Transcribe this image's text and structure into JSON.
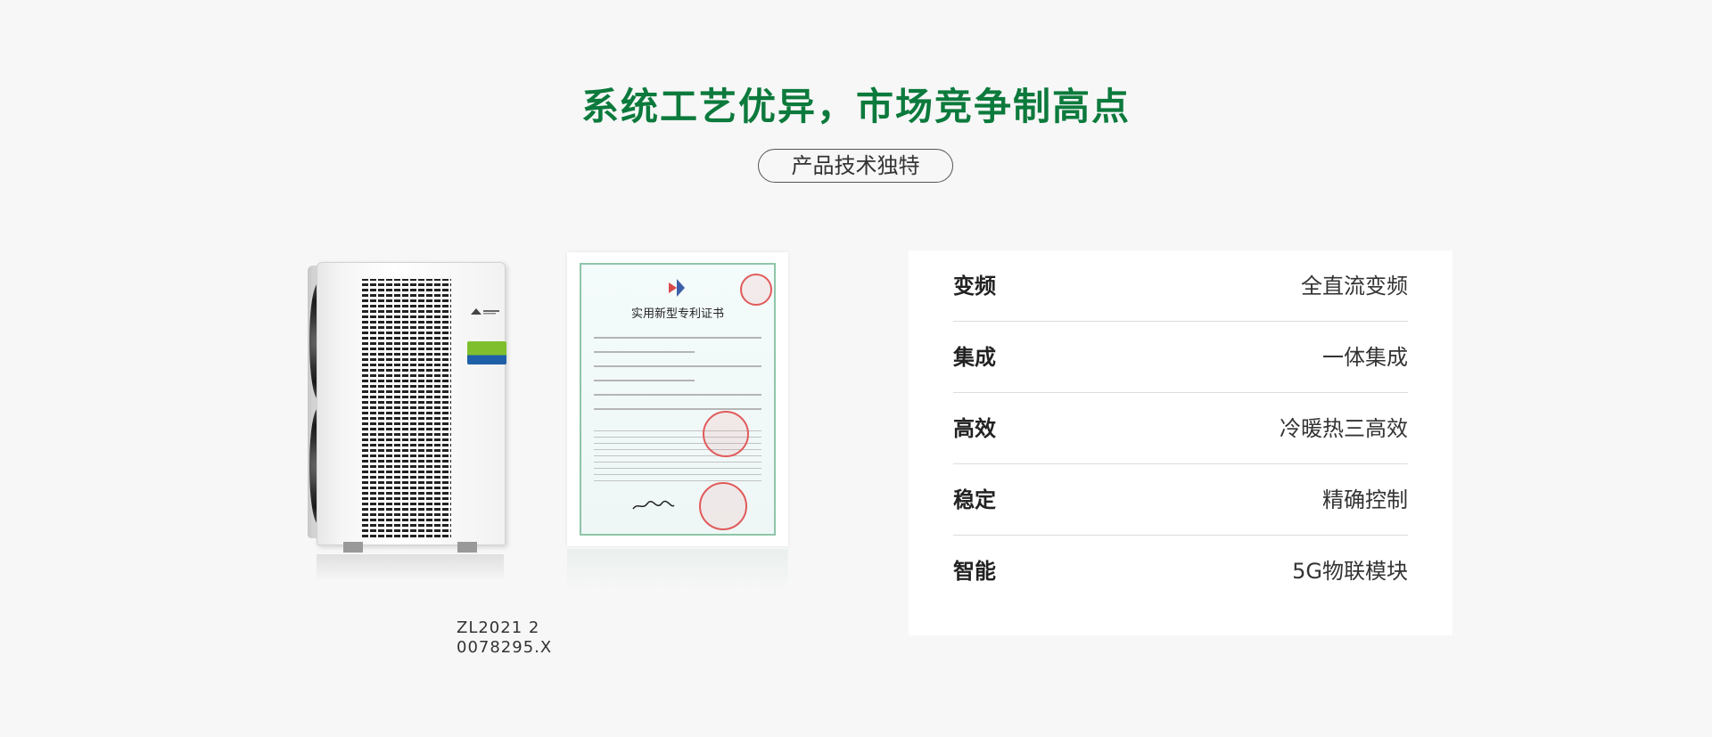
{
  "section": {
    "headline": "系统工艺优异，市场竞争制高点",
    "subtitle": "产品技术独特"
  },
  "product_images": {
    "unit_name": "heat-pump-unit",
    "certificate_title": "实用新型专利证书",
    "patent_number": "ZL2021 2 0078295.X"
  },
  "specs": {
    "rows": [
      {
        "key": "变频",
        "value": "全直流变频"
      },
      {
        "key": "集成",
        "value": "一体集成"
      },
      {
        "key": "高效",
        "value": "冷暖热三高效"
      },
      {
        "key": "稳定",
        "value": "精确控制"
      },
      {
        "key": "智能",
        "value": "5G物联模块"
      }
    ]
  },
  "colors": {
    "headline": "#0c7a3c",
    "background": "#f7f7f7",
    "card": "#ffffff",
    "divider": "#dcdcdc"
  }
}
